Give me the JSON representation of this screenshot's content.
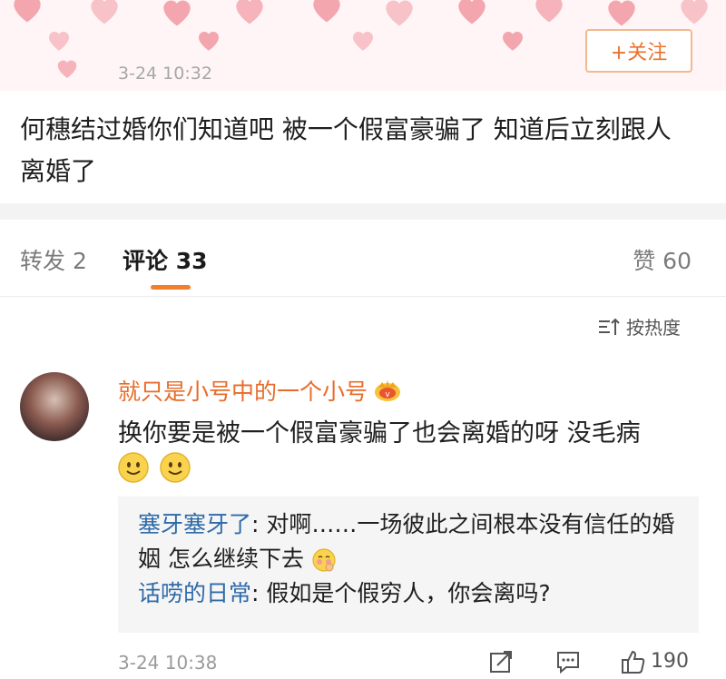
{
  "post": {
    "time": "3-24 10:32",
    "follow_label": "+关注",
    "text": "何穗结过婚你们知道吧  被一个假富豪骗了  知道后立刻跟人离婚了"
  },
  "tabs": {
    "repost": "转发 2",
    "comment": "评论 33",
    "like": "赞 60"
  },
  "sort_label": "按热度",
  "comment": {
    "username": "就只是小号中的一个小号",
    "text": "换你要是被一个假富豪骗了也会离婚的呀 没毛病",
    "replies": [
      {
        "user": "塞牙塞牙了",
        "text": ": 对啊……一场彼此之间根本没有信任的婚姻 怎么继续下去"
      },
      {
        "user": "话唠的日常",
        "text": ": 假如是个假穷人，你会离吗?"
      }
    ],
    "time": "3-24 10:38",
    "like_count": "190"
  },
  "colors": {
    "accent": "#e86b2a",
    "link": "#2f6aa8",
    "heart": "#f4a6ae"
  }
}
